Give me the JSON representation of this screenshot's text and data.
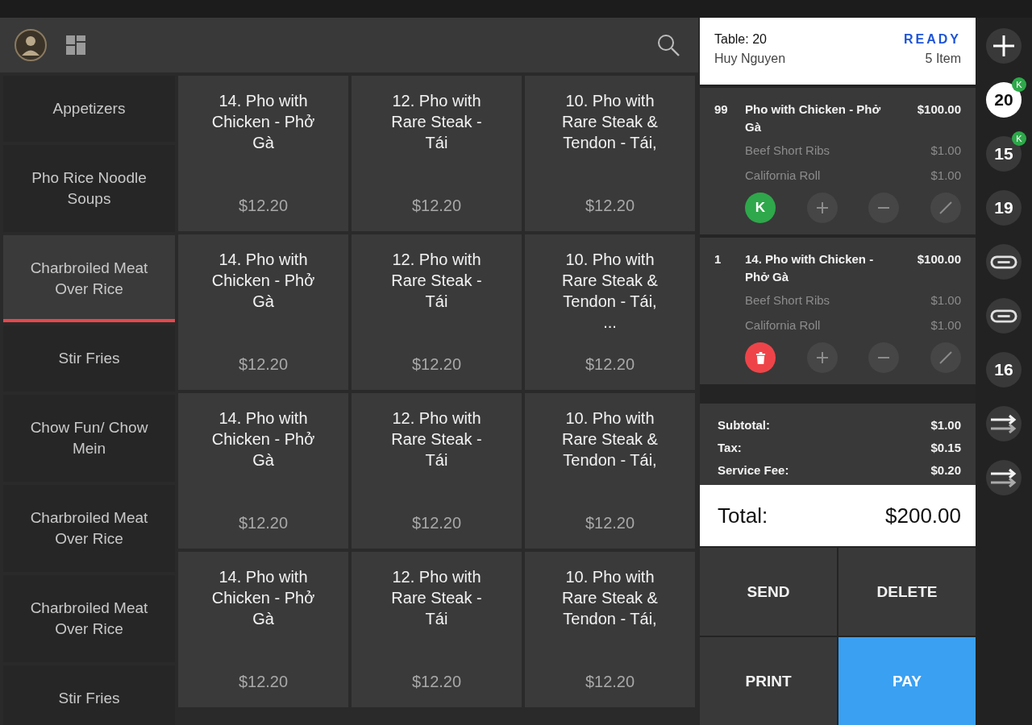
{
  "categories": [
    {
      "label": "Appetizers",
      "selected": false
    },
    {
      "label": "Pho Rice Noodle Soups",
      "selected": false
    },
    {
      "label": "Charbroiled Meat Over Rice",
      "selected": true
    },
    {
      "label": "Stir Fries",
      "selected": false
    },
    {
      "label": "Chow Fun/ Chow Mein",
      "selected": false
    },
    {
      "label": "Charbroiled Meat Over Rice",
      "selected": false
    },
    {
      "label": "Charbroiled Meat Over Rice",
      "selected": false
    },
    {
      "label": "Stir Fries",
      "selected": false
    }
  ],
  "menu_items": [
    {
      "name": "14. Pho with Chicken - Phở Gà",
      "price": "$12.20"
    },
    {
      "name": "12. Pho with Rare Steak - Tái",
      "price": "$12.20"
    },
    {
      "name": "10. Pho with Rare Steak & Tendon - Tái,",
      "price": "$12.20"
    },
    {
      "name": "14. Pho with Chicken - Phở Gà",
      "price": "$12.20"
    },
    {
      "name": "12. Pho with Rare Steak - Tái",
      "price": "$12.20"
    },
    {
      "name": "10. Pho with Rare Steak & Tendon - Tái, ...",
      "price": "$12.20"
    },
    {
      "name": "14. Pho with Chicken - Phở Gà",
      "price": "$12.20"
    },
    {
      "name": "12. Pho with Rare Steak - Tái",
      "price": "$12.20"
    },
    {
      "name": "10. Pho with Rare Steak & Tendon - Tái,",
      "price": "$12.20"
    },
    {
      "name": "14. Pho with Chicken - Phở Gà",
      "price": "$12.20"
    },
    {
      "name": "12. Pho with Rare Steak - Tái",
      "price": "$12.20"
    },
    {
      "name": "10. Pho with Rare Steak & Tendon - Tái,",
      "price": "$12.20"
    }
  ],
  "order": {
    "table": "Table: 20",
    "customer": "Huy Nguyen",
    "status": "READY",
    "item_count": "5 Item",
    "lines": [
      {
        "qty": "99",
        "name": "Pho with Chicken - Phở Gà",
        "price": "$100.00",
        "modifiers": [
          {
            "name": "Beef Short Ribs",
            "price": "$1.00"
          },
          {
            "name": "California Roll",
            "price": "$1.00"
          }
        ],
        "first_action": {
          "kind": "kitchen",
          "label": "K"
        }
      },
      {
        "qty": "1",
        "name": "14. Pho with Chicken - Phở Gà",
        "price": "$100.00",
        "modifiers": [
          {
            "name": "Beef Short Ribs",
            "price": "$1.00"
          },
          {
            "name": "California Roll",
            "price": "$1.00"
          }
        ],
        "first_action": {
          "kind": "delete"
        }
      }
    ],
    "summary": [
      {
        "label": "Subtotal:",
        "value": "$1.00"
      },
      {
        "label": "Tax:",
        "value": "$0.15"
      },
      {
        "label": "Service Fee:",
        "value": "$0.20"
      }
    ],
    "total": {
      "label": "Total:",
      "value": "$200.00"
    },
    "buttons": [
      {
        "label": "SEND",
        "kind": "plain"
      },
      {
        "label": "DELETE",
        "kind": "plain"
      },
      {
        "label": "PRINT",
        "kind": "plain"
      },
      {
        "label": "PAY",
        "kind": "primary"
      }
    ]
  },
  "rail": [
    {
      "kind": "add"
    },
    {
      "kind": "table",
      "label": "20",
      "selected": true,
      "badge": "K"
    },
    {
      "kind": "table",
      "label": "15",
      "selected": false,
      "badge": "K"
    },
    {
      "kind": "table",
      "label": "19",
      "selected": false
    },
    {
      "kind": "link"
    },
    {
      "kind": "link"
    },
    {
      "kind": "table",
      "label": "16",
      "selected": false
    },
    {
      "kind": "transfer"
    },
    {
      "kind": "transfer"
    }
  ]
}
